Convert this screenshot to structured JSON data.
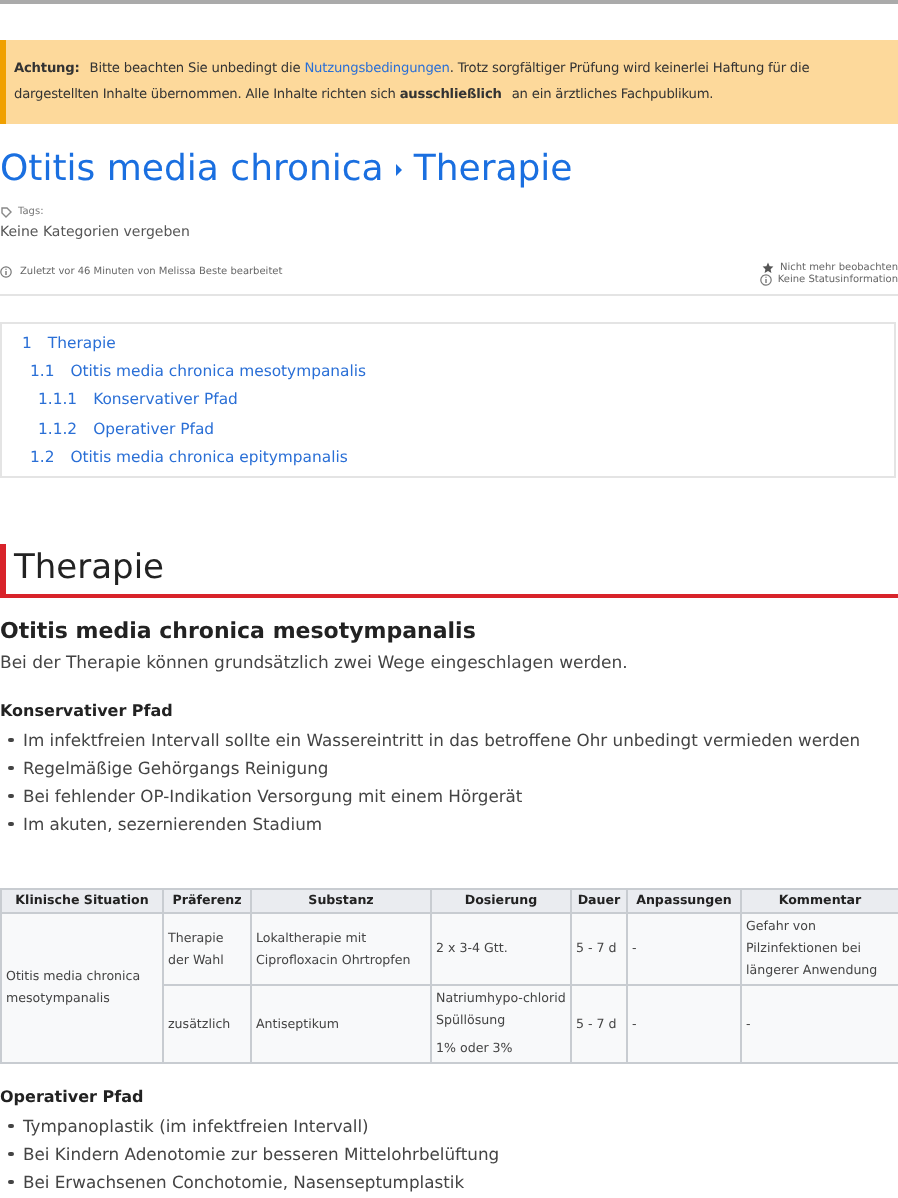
{
  "notice": {
    "label": "Achtung:",
    "text": "Bitte beachten Sie unbedingt die",
    "link": "Nutzungsbedingungen",
    "rest": ". Trotz sorgfältiger Prüfung wird keinerlei Haftung für die dargestellten Inhalte übernommen. Alle Inhalte richten sich **ausschließlich** an ein ärztliches Fachpublikum."
  },
  "breadcrumb": [
    {
      "title": "Otitis media chronica"
    },
    {
      "title": "Therapie"
    }
  ],
  "tags": {
    "label": "Tags:",
    "value": "Keine Kategorien vergeben"
  },
  "last_edit": "Zuletzt vor 46 Minuten von Melissa Beste bearbeitet",
  "actions": [
    {
      "kind": "star",
      "label": "Nicht mehr beobachten"
    },
    {
      "kind": "info",
      "label": "Keine Statusinformation"
    }
  ],
  "toc": [
    {
      "number": "1",
      "title": "Therapie",
      "children": [
        {
          "number": "1.1",
          "title": "Otitis media chronica mesotympanalis",
          "children": [
            {
              "number": "1.1.1",
              "title": "Konservativer Pfad"
            },
            {
              "number": "1.1.2",
              "title": "Operativer Pfad"
            }
          ]
        },
        {
          "number": "1.2",
          "title": "Otitis media chronica epitympanalis"
        }
      ]
    }
  ],
  "section": {
    "heading": "Therapie",
    "subheading": "Otitis media chronica mesotympanalis",
    "intro": "Bei der Therapie können grundsätzlich zwei Wege eingeschlagen werden.",
    "conservative": {
      "heading": "Konservativer Pfad",
      "items": [
        "Im infektfreien Intervall sollte ein Wassereintritt in das betroffene Ohr unbedingt vermieden werden",
        "Regelmäßige Gehörgangs Reinigung",
        "Bei fehlender OP-Indikation Versorgung mit einem Hörgerät",
        "Im akuten, sezernierenden Stadium"
      ]
    },
    "table": {
      "columns": [
        "Klinische Situation",
        "Präferenz",
        "Substanz",
        "Dosierung",
        "Dauer",
        "Anpassungen",
        "Kommentar"
      ],
      "rows": [
        [
          {
            "text": "Otitis media chronica mesotympanalis",
            "rowspan": 2
          },
          "Therapie der Wahl",
          "Lokaltherapie mit Ciprofloxacin Ohrtropfen",
          [
            "2 x 3-4 Gtt."
          ],
          "5 - 7 d",
          "-",
          "Gefahr von Pilzinfektionen bei längerer Anwendung"
        ],
        [
          "zusätzlich",
          "Antiseptikum",
          [
            "Natriumhypo-chlorid Spüllösung",
            "1% oder 3%"
          ],
          "5 - 7 d",
          "-",
          "-"
        ]
      ]
    },
    "operative": {
      "heading": "Operativer Pfad",
      "items": [
        "Tympanoplastik (im infektfreien Intervall)",
        "Bei Kindern Adenotomie zur besseren Mittelohrbelüftung",
        "Bei Erwachsenen Conchotomie, Nasenseptumplastik"
      ]
    }
  }
}
